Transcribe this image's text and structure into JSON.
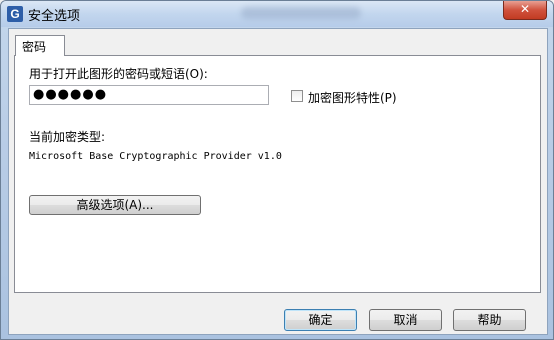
{
  "window": {
    "title": "安全选项",
    "app_icon": "G",
    "close_glyph": "✕"
  },
  "tabs": [
    {
      "label": "密码"
    }
  ],
  "password": {
    "open_label": "用于打开此图形的密码或短语(O):",
    "value": "●●●●●●",
    "encrypt_props_label": "加密图形特性(P)",
    "encrypt_props_checked": false
  },
  "encryption": {
    "type_label": "当前加密类型:",
    "provider": "Microsoft Base Cryptographic Provider v1.0",
    "advanced_button": "高级选项(A)..."
  },
  "footer": {
    "ok": "确定",
    "cancel": "取消",
    "help": "帮助"
  }
}
